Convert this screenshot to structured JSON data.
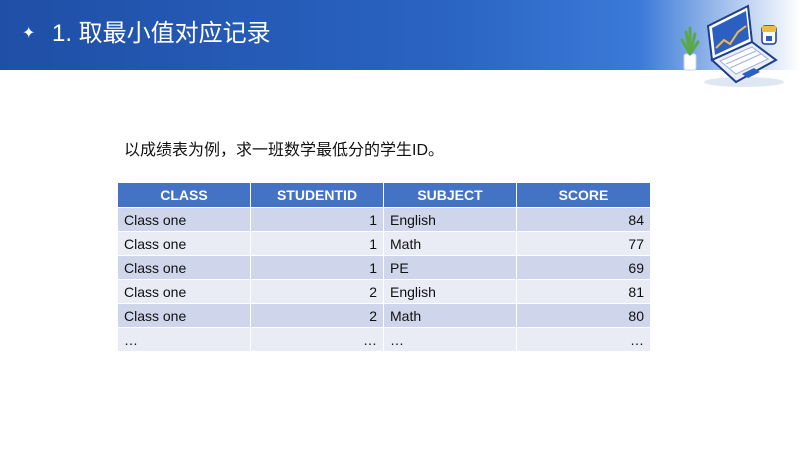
{
  "header": {
    "title": "1. 取最小值对应记录",
    "star_icon": "sparkle-icon"
  },
  "intro": "以成绩表为例，求一班数学最低分的学生ID。",
  "table": {
    "columns": [
      "CLASS",
      "STUDENTID",
      "SUBJECT",
      "SCORE"
    ],
    "rows": [
      [
        "Class one",
        "1",
        "English",
        "84"
      ],
      [
        "Class one",
        "1",
        "Math",
        "77"
      ],
      [
        "Class one",
        "1",
        "PE",
        "69"
      ],
      [
        "Class one",
        "2",
        "English",
        "81"
      ],
      [
        "Class one",
        "2",
        "Math",
        "80"
      ],
      [
        "…",
        "…",
        "…",
        "…"
      ]
    ]
  },
  "colors": {
    "header": "#2a63c2",
    "table_header": "#4472c4",
    "row_odd": "#cfd5ea",
    "row_even": "#e9ebf5"
  }
}
